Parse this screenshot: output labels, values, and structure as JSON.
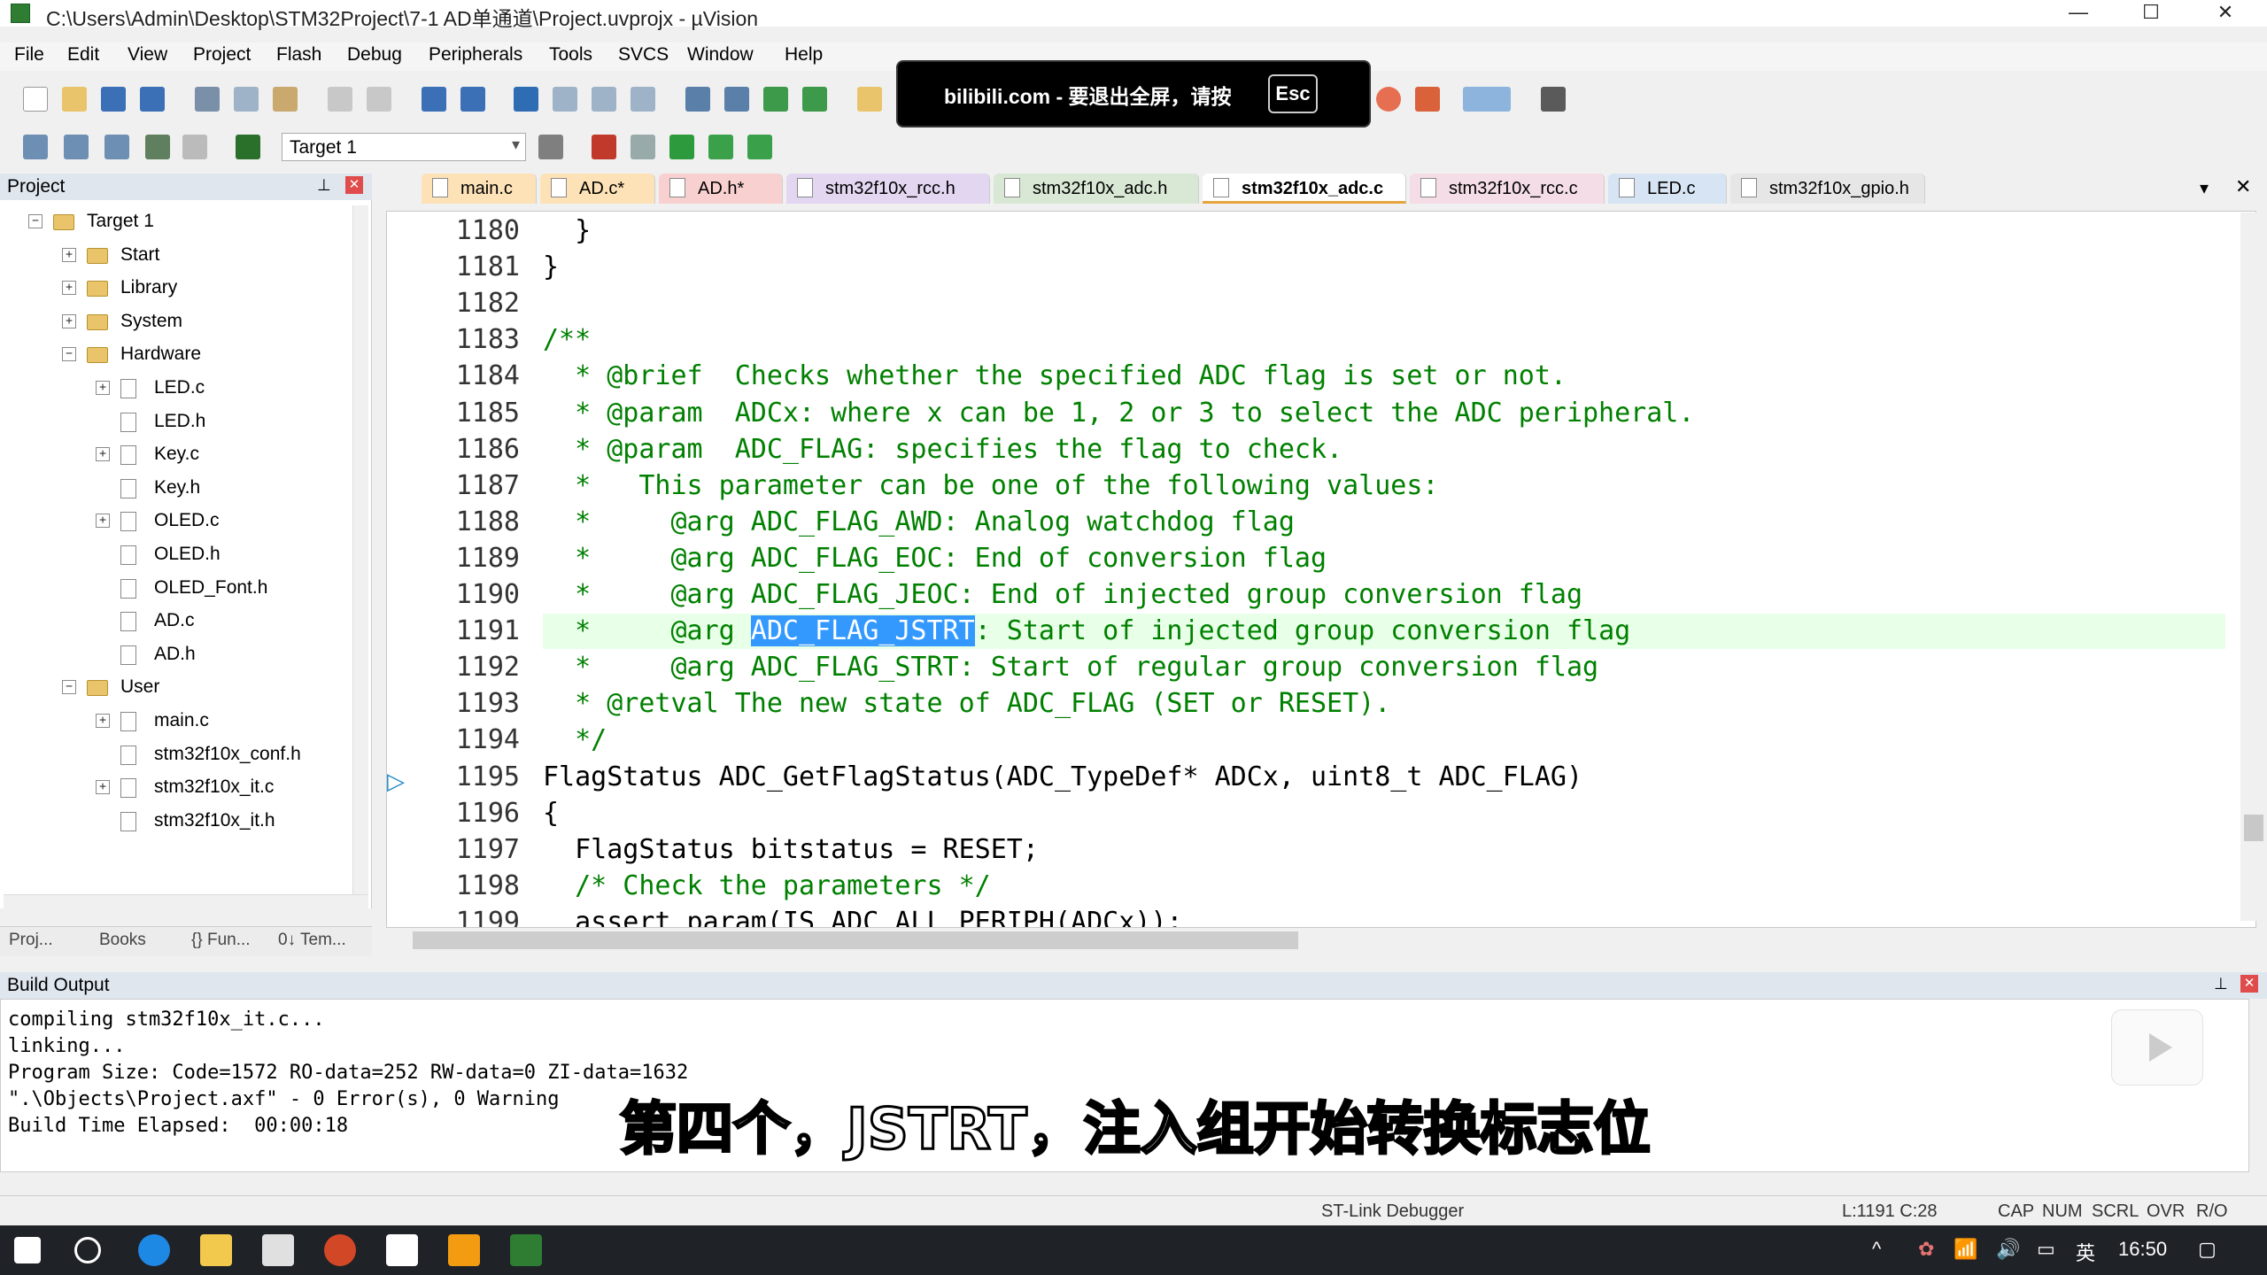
{
  "window": {
    "title": "C:\\Users\\Admin\\Desktop\\STM32Project\\7-1 AD单通道\\Project.uvprojx - µVision"
  },
  "menu": [
    "File",
    "Edit",
    "View",
    "Project",
    "Flash",
    "Debug",
    "Peripherals",
    "Tools",
    "SVCS",
    "Window",
    "Help"
  ],
  "toolbar": {
    "target": "Target 1"
  },
  "overlay": {
    "text": "bilibili.com - 要退出全屏，请按",
    "key": "Esc"
  },
  "project": {
    "title": "Project",
    "tree": [
      {
        "label": "Target 1",
        "level": 0,
        "type": "folder",
        "toggle": "−"
      },
      {
        "label": "Start",
        "level": 1,
        "type": "folder",
        "toggle": "+"
      },
      {
        "label": "Library",
        "level": 1,
        "type": "folder",
        "toggle": "+"
      },
      {
        "label": "System",
        "level": 1,
        "type": "folder",
        "toggle": "+"
      },
      {
        "label": "Hardware",
        "level": 1,
        "type": "folder",
        "toggle": "−"
      },
      {
        "label": "LED.c",
        "level": 2,
        "type": "file",
        "toggle": "+"
      },
      {
        "label": "LED.h",
        "level": 2,
        "type": "file",
        "toggle": ""
      },
      {
        "label": "Key.c",
        "level": 2,
        "type": "file",
        "toggle": "+"
      },
      {
        "label": "Key.h",
        "level": 2,
        "type": "file",
        "toggle": ""
      },
      {
        "label": "OLED.c",
        "level": 2,
        "type": "file",
        "toggle": "+"
      },
      {
        "label": "OLED.h",
        "level": 2,
        "type": "file",
        "toggle": ""
      },
      {
        "label": "OLED_Font.h",
        "level": 2,
        "type": "file",
        "toggle": ""
      },
      {
        "label": "AD.c",
        "level": 2,
        "type": "file",
        "toggle": ""
      },
      {
        "label": "AD.h",
        "level": 2,
        "type": "file",
        "toggle": ""
      },
      {
        "label": "User",
        "level": 1,
        "type": "folder",
        "toggle": "−"
      },
      {
        "label": "main.c",
        "level": 2,
        "type": "file",
        "toggle": "+"
      },
      {
        "label": "stm32f10x_conf.h",
        "level": 2,
        "type": "file",
        "toggle": ""
      },
      {
        "label": "stm32f10x_it.c",
        "level": 2,
        "type": "file",
        "toggle": "+"
      },
      {
        "label": "stm32f10x_it.h",
        "level": 2,
        "type": "file",
        "toggle": ""
      }
    ],
    "tabs": [
      "Proj...",
      "Books",
      "{} Fun...",
      "0↓ Tem..."
    ]
  },
  "editor": {
    "tabs": [
      {
        "label": "main.c",
        "color": "#fde2b8",
        "active": false
      },
      {
        "label": "AD.c*",
        "color": "#fde2b8",
        "active": false
      },
      {
        "label": "AD.h*",
        "color": "#f9d0d0",
        "active": false
      },
      {
        "label": "stm32f10x_rcc.h",
        "color": "#e3d6f1",
        "active": false
      },
      {
        "label": "stm32f10x_adc.h",
        "color": "#d8e8d4",
        "active": false
      },
      {
        "label": "stm32f10x_adc.c",
        "color": "#ffffff",
        "active": true
      },
      {
        "label": "stm32f10x_rcc.c",
        "color": "#f4dde6",
        "active": false
      },
      {
        "label": "LED.c",
        "color": "#d6e4f3",
        "active": false
      },
      {
        "label": "stm32f10x_gpio.h",
        "color": "#e6e6e6",
        "active": false
      }
    ],
    "lines": [
      {
        "n": "1180",
        "text": "  }",
        "cls": ""
      },
      {
        "n": "1181",
        "text": "}",
        "cls": ""
      },
      {
        "n": "1182",
        "text": "",
        "cls": ""
      },
      {
        "n": "1183",
        "text": "/**",
        "cls": "cmt"
      },
      {
        "n": "1184",
        "text": "  * @brief  Checks whether the specified ADC flag is set or not.",
        "cls": "cmt"
      },
      {
        "n": "1185",
        "text": "  * @param  ADCx: where x can be 1, 2 or 3 to select the ADC peripheral.",
        "cls": "cmt"
      },
      {
        "n": "1186",
        "text": "  * @param  ADC_FLAG: specifies the flag to check.",
        "cls": "cmt"
      },
      {
        "n": "1187",
        "text": "  *   This parameter can be one of the following values:",
        "cls": "cmt"
      },
      {
        "n": "1188",
        "text": "  *     @arg ADC_FLAG_AWD: Analog watchdog flag",
        "cls": "cmt"
      },
      {
        "n": "1189",
        "text": "  *     @arg ADC_FLAG_EOC: End of conversion flag",
        "cls": "cmt"
      },
      {
        "n": "1190",
        "text": "  *     @arg ADC_FLAG_JEOC: End of injected group conversion flag",
        "cls": "cmt"
      },
      {
        "n": "1191",
        "pre": "  *     @arg ",
        "sel": "ADC_FLAG_JSTRT",
        "post": ": Start of injected group conversion flag",
        "cls": "cmt"
      },
      {
        "n": "1192",
        "text": "  *     @arg ADC_FLAG_STRT: Start of regular group conversion flag",
        "cls": "cmt"
      },
      {
        "n": "1193",
        "text": "  * @retval The new state of ADC_FLAG (SET or RESET).",
        "cls": "cmt"
      },
      {
        "n": "1194",
        "text": "  */",
        "cls": "cmt"
      },
      {
        "n": "1195",
        "text": "FlagStatus ADC_GetFlagStatus(ADC_TypeDef* ADCx, uint8_t ADC_FLAG)",
        "cls": ""
      },
      {
        "n": "1196",
        "text": "{",
        "cls": ""
      },
      {
        "n": "1197",
        "text": "  FlagStatus bitstatus = RESET;",
        "cls": ""
      },
      {
        "n": "1198",
        "text": "  /* Check the parameters */",
        "cls": "cmt"
      },
      {
        "n": "1199",
        "text": "  assert_param(IS_ADC_ALL_PERIPH(ADCx));",
        "cls": ""
      }
    ]
  },
  "build": {
    "title": "Build Output",
    "lines": [
      "compiling stm32f10x_it.c...",
      "linking...",
      "Program Size: Code=1572 RO-data=252 RW-data=0 ZI-data=1632",
      "\".\\Objects\\Project.axf\" - 0 Error(s), 0 Warning",
      "Build Time Elapsed:  00:00:18"
    ],
    "subtitle": "第四个，JSTRT，注入组开始转换标志位"
  },
  "status": {
    "debugger": "ST-Link Debugger",
    "position": "L:1191 C:28",
    "flags": [
      "CAP",
      "NUM",
      "SCRL",
      "OVR",
      "R/O"
    ]
  },
  "taskbar": {
    "ime": "英",
    "time": "16:50"
  }
}
